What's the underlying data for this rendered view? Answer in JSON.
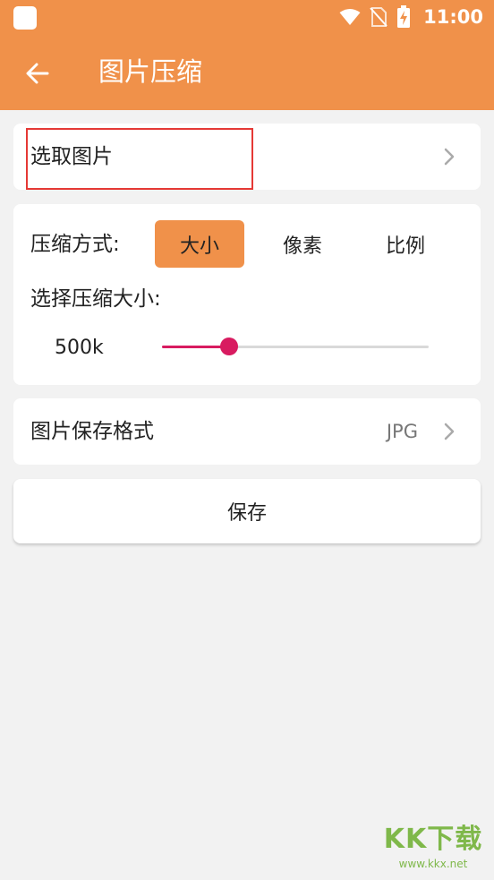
{
  "status_bar": {
    "time": "11:00",
    "icons": [
      "app-square-icon",
      "wifi-icon",
      "no-sim-icon",
      "battery-charging-icon"
    ]
  },
  "app_bar": {
    "back_icon": "arrow-left-icon",
    "title": "图片压缩"
  },
  "pick_image": {
    "label": "选取图片",
    "chevron_icon": "chevron-right-icon"
  },
  "compression": {
    "mode_label": "压缩方式:",
    "modes": [
      "大小",
      "像素",
      "比例"
    ],
    "selected_mode": "大小",
    "size_label": "选择压缩大小:",
    "size_value": "500k",
    "slider_fraction": 0.25
  },
  "save_format": {
    "label": "图片保存格式",
    "value": "JPG",
    "chevron_icon": "chevron-right-icon"
  },
  "save_button": {
    "label": "保存"
  },
  "watermark": {
    "brand": "KK下载",
    "url": "www.kkx.net"
  },
  "colors": {
    "primary": "#f0914a",
    "slider_accent": "#d81b60",
    "highlight_border": "#e53935",
    "background": "#f2f2f2"
  }
}
